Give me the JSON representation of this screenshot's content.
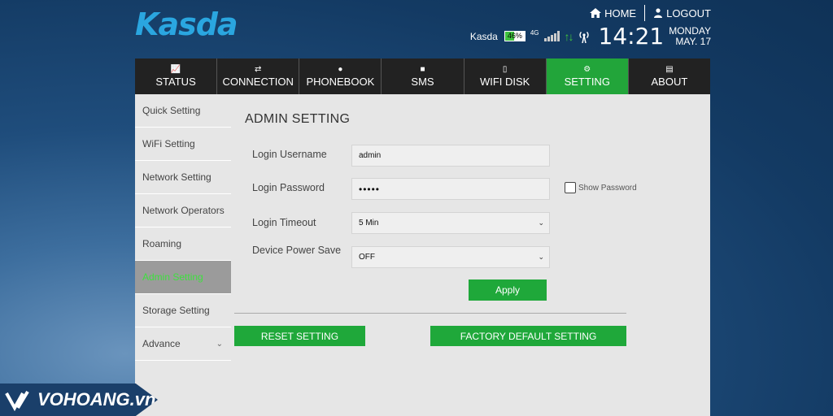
{
  "header": {
    "logo": "Kasda",
    "home_label": "HOME",
    "logout_label": "LOGOUT",
    "brand": "Kasda",
    "battery": "46%",
    "network": "4G",
    "time": "14:21",
    "day": "MONDAY",
    "date": "MAY. 17",
    "colors": {
      "logo": "#2aa6e0",
      "accent": "#22a53a"
    }
  },
  "nav": {
    "tabs": [
      {
        "label": "STATUS",
        "icon": "chart-icon"
      },
      {
        "label": "CONNECTION",
        "icon": "swap-icon"
      },
      {
        "label": "PHONEBOOK",
        "icon": "person-icon"
      },
      {
        "label": "SMS",
        "icon": "message-icon"
      },
      {
        "label": "WIFI DISK",
        "icon": "phone-icon"
      },
      {
        "label": "SETTING",
        "icon": "gears-icon",
        "active": true
      },
      {
        "label": "ABOUT",
        "icon": "book-icon"
      }
    ]
  },
  "sidebar": {
    "items": [
      {
        "label": "Quick Setting"
      },
      {
        "label": "WiFi Setting"
      },
      {
        "label": "Network Setting"
      },
      {
        "label": "Network Operators"
      },
      {
        "label": "Roaming"
      },
      {
        "label": "Admin Setting",
        "active": true
      },
      {
        "label": "Storage Setting"
      },
      {
        "label": "Advance"
      }
    ]
  },
  "main": {
    "title": "ADMIN SETTING",
    "username_label": "Login Username",
    "username_value": "admin",
    "password_label": "Login Password",
    "password_value": "•••••",
    "show_password_label": "Show Password",
    "timeout_label": "Login Timeout",
    "timeout_value": "5 Min",
    "power_label": "Device Power Save",
    "power_value": "OFF",
    "apply_label": "Apply",
    "reset_label": "RESET SETTING",
    "factory_label": "FACTORY DEFAULT SETTING"
  },
  "watermark": {
    "text": "VOHOANG.vn"
  }
}
